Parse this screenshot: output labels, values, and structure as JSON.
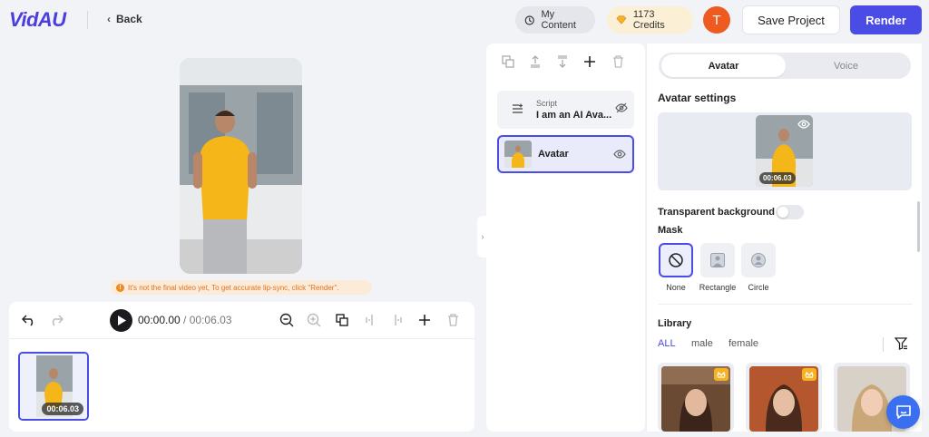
{
  "app": {
    "logo": "VidAU"
  },
  "header": {
    "back_label": "Back",
    "my_content_label": "My Content",
    "credits_label": "1173 Credits",
    "user_initial": "T",
    "save_label": "Save Project",
    "render_label": "Render",
    "accent_color": "#4b4be6"
  },
  "preview": {
    "notice": "It's not the final video yet, To get accurate lip-sync, click \"Render\"."
  },
  "timeline": {
    "current_time": "00:00.00",
    "separator": " / ",
    "total_time": "00:06.03",
    "clip_duration": "00:06.03"
  },
  "layers": {
    "items": [
      {
        "type_label": "Script",
        "name": "I am an AI Ava..."
      },
      {
        "name": "Avatar"
      }
    ]
  },
  "settings": {
    "tabs": [
      {
        "label": "Avatar",
        "active": true
      },
      {
        "label": "Voice",
        "active": false
      }
    ],
    "section_title": "Avatar settings",
    "preview_duration": "00:06.03",
    "transparent_label": "Transparent background",
    "transparent_on": false,
    "mask_label": "Mask",
    "mask_options": [
      {
        "label": "None",
        "selected": true
      },
      {
        "label": "Rectangle",
        "selected": false
      },
      {
        "label": "Circle",
        "selected": false
      }
    ],
    "library_label": "Library",
    "filters": [
      {
        "label": "ALL",
        "active": true
      },
      {
        "label": "male",
        "active": false
      },
      {
        "label": "female",
        "active": false
      }
    ]
  }
}
